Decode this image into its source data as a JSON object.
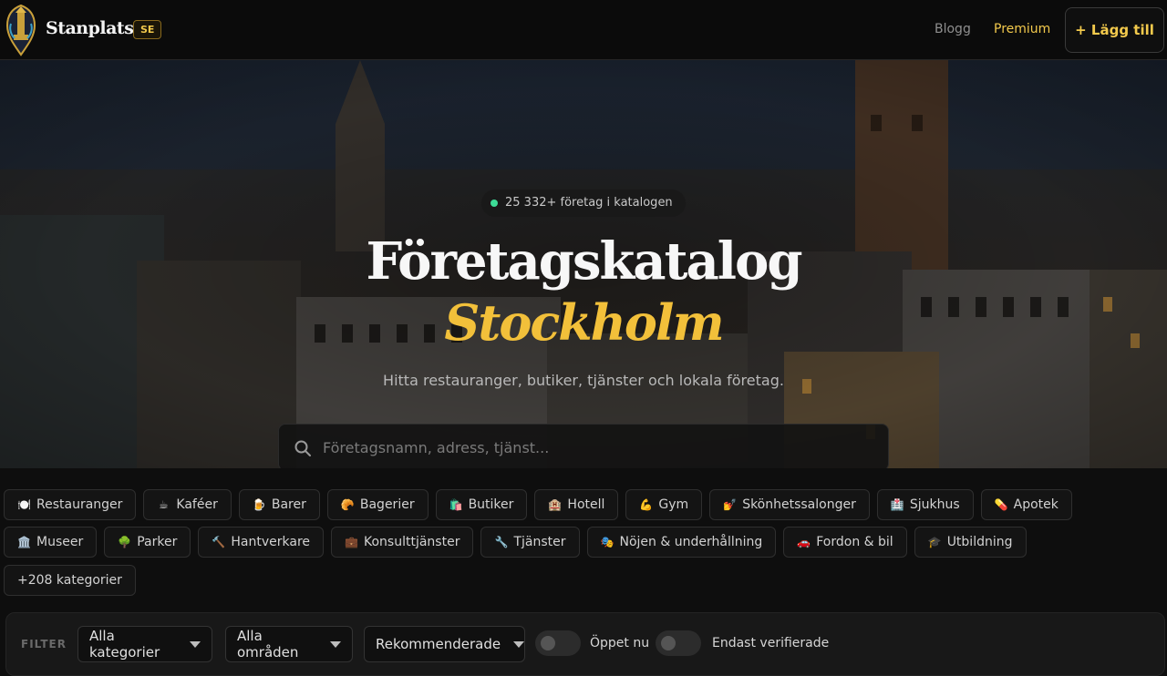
{
  "header": {
    "brand": "Stanplats",
    "country": "SE",
    "nav_blog": "Blogg",
    "nav_premium": "Premium",
    "add_button": "+ Lägg till"
  },
  "hero": {
    "count_text": "25 332+ företag i katalogen",
    "title": "Företagskatalog",
    "city": "Stockholm",
    "subtitle": "Hitta restauranger, butiker, tjänster och lokala företag.",
    "search_placeholder": "Företagsnamn, adress, tjänst..."
  },
  "categories_row1": [
    {
      "icon": "🍽️",
      "label": "Restauranger"
    },
    {
      "icon": "☕",
      "label": "Kaféer"
    },
    {
      "icon": "🍺",
      "label": "Barer"
    },
    {
      "icon": "🥐",
      "label": "Bagerier"
    },
    {
      "icon": "🛍️",
      "label": "Butiker"
    },
    {
      "icon": "🏨",
      "label": "Hotell"
    },
    {
      "icon": "💪",
      "label": "Gym"
    },
    {
      "icon": "💅",
      "label": "Skönhetssalonger"
    },
    {
      "icon": "🏥",
      "label": "Sjukhus"
    },
    {
      "icon": "💊",
      "label": "Apotek"
    }
  ],
  "categories_row2": [
    {
      "icon": "🏛️",
      "label": "Museer"
    },
    {
      "icon": "🌳",
      "label": "Parker"
    },
    {
      "icon": "🔨",
      "label": "Hantverkare"
    },
    {
      "icon": "💼",
      "label": "Konsulttjänster"
    },
    {
      "icon": "🔧",
      "label": "Tjänster"
    },
    {
      "icon": "🎭",
      "label": "Nöjen & underhållning"
    },
    {
      "icon": "🚗",
      "label": "Fordon & bil"
    },
    {
      "icon": "🎓",
      "label": "Utbildning"
    }
  ],
  "more_categories": "+208 kategorier",
  "filters": {
    "label": "FILTER",
    "category": "Alla kategorier",
    "area": "Alla områden",
    "sort": "Rekommenderade",
    "open_now": "Öppet nu",
    "verified_only": "Endast verifierade"
  },
  "colors": {
    "accent": "#f2c03a",
    "background": "#0e0e0e",
    "status_dot": "#3ddc97"
  }
}
